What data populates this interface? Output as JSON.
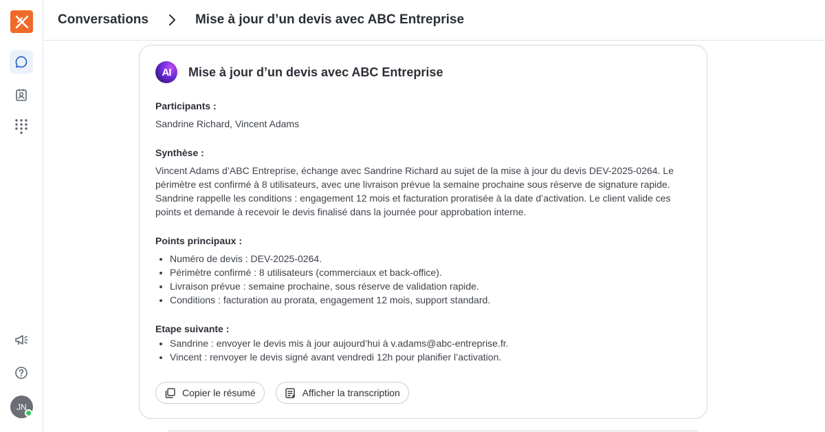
{
  "app": {
    "logo_icon": "x-logo-icon",
    "brand_color": "#f06a2a",
    "accent_color": "#3b6fd1"
  },
  "sidebar": {
    "top_items": [
      {
        "icon": "chat-bubble-icon",
        "active": true
      },
      {
        "icon": "contact-card-icon",
        "active": false
      },
      {
        "icon": "dialpad-icon",
        "active": false
      }
    ],
    "bottom_items": [
      {
        "icon": "megaphone-icon"
      },
      {
        "icon": "help-icon"
      }
    ],
    "avatar": {
      "initials": "JN",
      "status_color": "#34c759"
    }
  },
  "breadcrumb": {
    "root": "Conversations",
    "current": "Mise à jour d’un devis avec ABC Entreprise"
  },
  "card": {
    "badge": "AI",
    "title": "Mise à jour d’un devis avec ABC Entreprise",
    "participants_label": "Participants :",
    "participants": "Sandrine Richard, Vincent Adams",
    "summary_label": "Synthèse :",
    "summary": "Vincent Adams d’ABC Entreprise, échange avec Sandrine Richard au sujet de la mise à jour du devis DEV-2025-0264. Le périmètre est confirmé à 8 utilisateurs, avec une livraison prévue la semaine prochaine sous réserve de signature rapide. Sandrine rappelle les conditions : engagement 12 mois et facturation proratisée à la date d’activation. Le client valide ces points et demande à recevoir le devis finalisé dans la journée pour approbation interne.",
    "key_points_label": "Points principaux :",
    "key_points": [
      "Numéro de devis : DEV-2025-0264.",
      "Périmètre confirmé : 8 utilisateurs (commerciaux et back-office).",
      "Livraison prévue : semaine prochaine, sous réserve de validation rapide.",
      "Conditions : facturation au prorata, engagement 12 mois, support standard."
    ],
    "next_steps_label": "Etape suivante :",
    "next_steps": [
      "Sandrine : envoyer le devis mis à jour aujourd’hui à v.adams@abc-entreprise.fr.",
      "Vincent : renvoyer le devis signé avant vendredi 12h pour planifier l’activation."
    ],
    "copy_button": "Copier le résumé",
    "transcript_button": "Afficher la transcription"
  }
}
